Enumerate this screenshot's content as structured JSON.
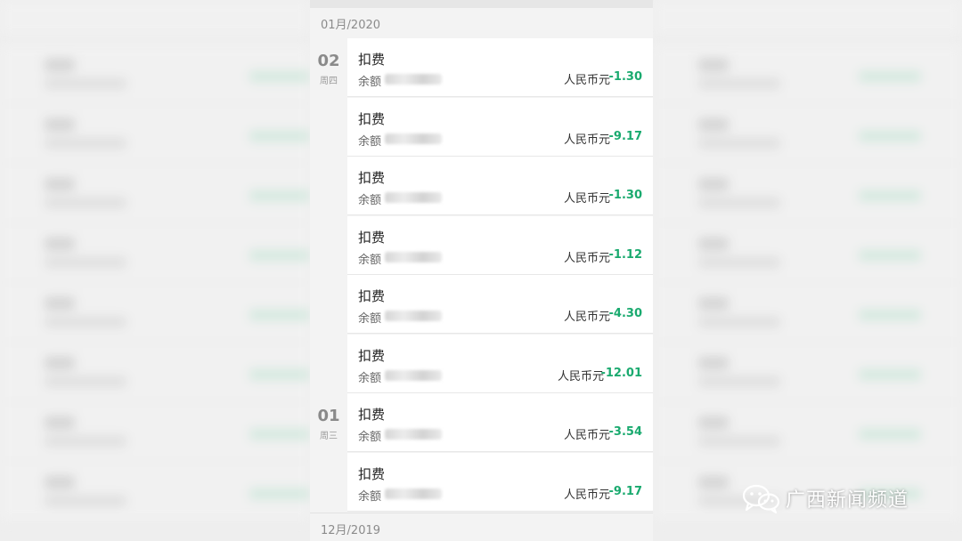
{
  "months": {
    "current": "01月/2020",
    "previous": "12月/2019"
  },
  "days": [
    {
      "day": "02",
      "weekday": "周四"
    },
    {
      "day": "01",
      "weekday": "周三"
    }
  ],
  "transactions": [
    {
      "title": "扣费",
      "balance_label": "余额",
      "currency": "人民币元",
      "amount": "-1.30"
    },
    {
      "title": "扣费",
      "balance_label": "余额",
      "currency": "人民币元",
      "amount": "-9.17"
    },
    {
      "title": "扣费",
      "balance_label": "余额",
      "currency": "人民币元",
      "amount": "-1.30"
    },
    {
      "title": "扣费",
      "balance_label": "余额",
      "currency": "人民币元",
      "amount": "-1.12"
    },
    {
      "title": "扣费",
      "balance_label": "余额",
      "currency": "人民币元",
      "amount": "-4.30"
    },
    {
      "title": "扣费",
      "balance_label": "余额",
      "currency": "人民币元",
      "amount": "-12.01"
    },
    {
      "title": "扣费",
      "balance_label": "余额",
      "currency": "人民币元",
      "amount": "-3.54"
    },
    {
      "title": "扣费",
      "balance_label": "余额",
      "currency": "人民币元",
      "amount": "-9.17"
    }
  ],
  "watermark": {
    "text": "广西新闻频道",
    "icon": "wechat-icon"
  },
  "colors": {
    "amount": "#1aaa6f",
    "background": "#f3f3f3"
  }
}
